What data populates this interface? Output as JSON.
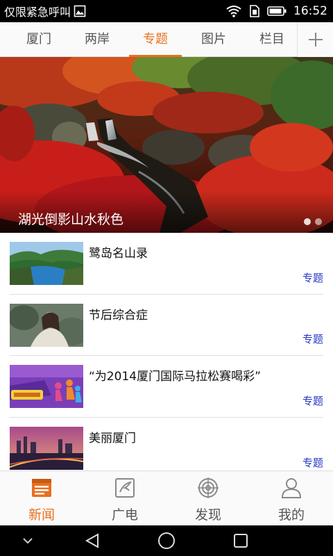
{
  "status_bar": {
    "carrier": "仅限紧急呼叫",
    "time": "16:52",
    "icons": [
      "image-icon",
      "wifi-icon",
      "sim-icon",
      "battery-icon"
    ]
  },
  "tabs": [
    {
      "label": "厦门",
      "active": false
    },
    {
      "label": "两岸",
      "active": false
    },
    {
      "label": "专题",
      "active": true
    },
    {
      "label": "图片",
      "active": false
    },
    {
      "label": "栏目",
      "active": false
    }
  ],
  "tab_add_icon": "plus-icon",
  "banner": {
    "caption": "湖光倒影山水秋色",
    "page_count": 2,
    "active_page": 1
  },
  "list": [
    {
      "title": "鹭岛名山录",
      "tag": "专题",
      "thumb": "lake-landscape"
    },
    {
      "title": "节后综合症",
      "tag": "专题",
      "thumb": "portrait-woman"
    },
    {
      "title": "“为2014厦门国际马拉松赛喝彩”",
      "tag": "专题",
      "thumb": "marathon-poster"
    },
    {
      "title": "美丽厦门",
      "tag": "专题",
      "thumb": "city-night"
    }
  ],
  "bottom_nav": [
    {
      "label": "新闻",
      "icon": "news-icon",
      "active": true
    },
    {
      "label": "广电",
      "icon": "broadcast-icon",
      "active": false
    },
    {
      "label": "发现",
      "icon": "discover-icon",
      "active": false
    },
    {
      "label": "我的",
      "icon": "profile-icon",
      "active": false
    }
  ],
  "colors": {
    "accent": "#e8701f",
    "tag": "#2436c9",
    "status_bar": "#000000"
  }
}
